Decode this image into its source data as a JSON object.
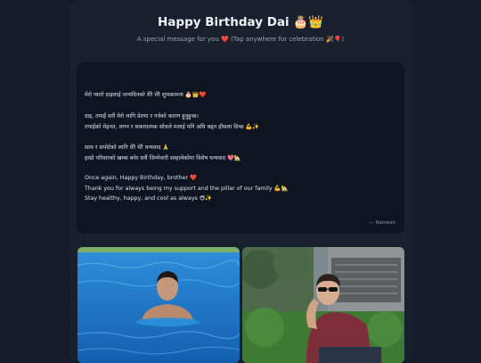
{
  "header": {
    "title": "Happy Birthday Dai 🎂👑",
    "subtitle": "A special message for you ❤️ (Tap anywhere for celebration 🎉🎈)"
  },
  "message": {
    "lines": [
      "मेरो प्यारो दाइलाई जन्मदिनको धेरै धेरै शुभकामना 🎂👑❤️",
      "",
      "दाइ, तपाईं सधैं मेरो लागि प्रेरणा र गर्वको कारण हुनुहुन्छ।",
      "तपाईंको मेहनत, लगन र सकारात्मक सोचले मलाई पनि अघि बढ्न हौसला दिन्छ 💪✨",
      "",
      "साथ र सपोर्टको लागि धेरै धेरै धन्यवाद 🙏",
      "हाम्रो परिवारको खम्बा बनेर सधैं जिम्मेवारी सम्हालेकोमा विशेष धन्यवाद 💖🏡",
      "",
      "Once again, Happy Birthday, brother ❤️",
      "Thank you for always being my support and the pillar of our family 💪🏡",
      "Stay healthy, happy, and cool as always 😎✨"
    ],
    "signature": "— Ramesh"
  }
}
